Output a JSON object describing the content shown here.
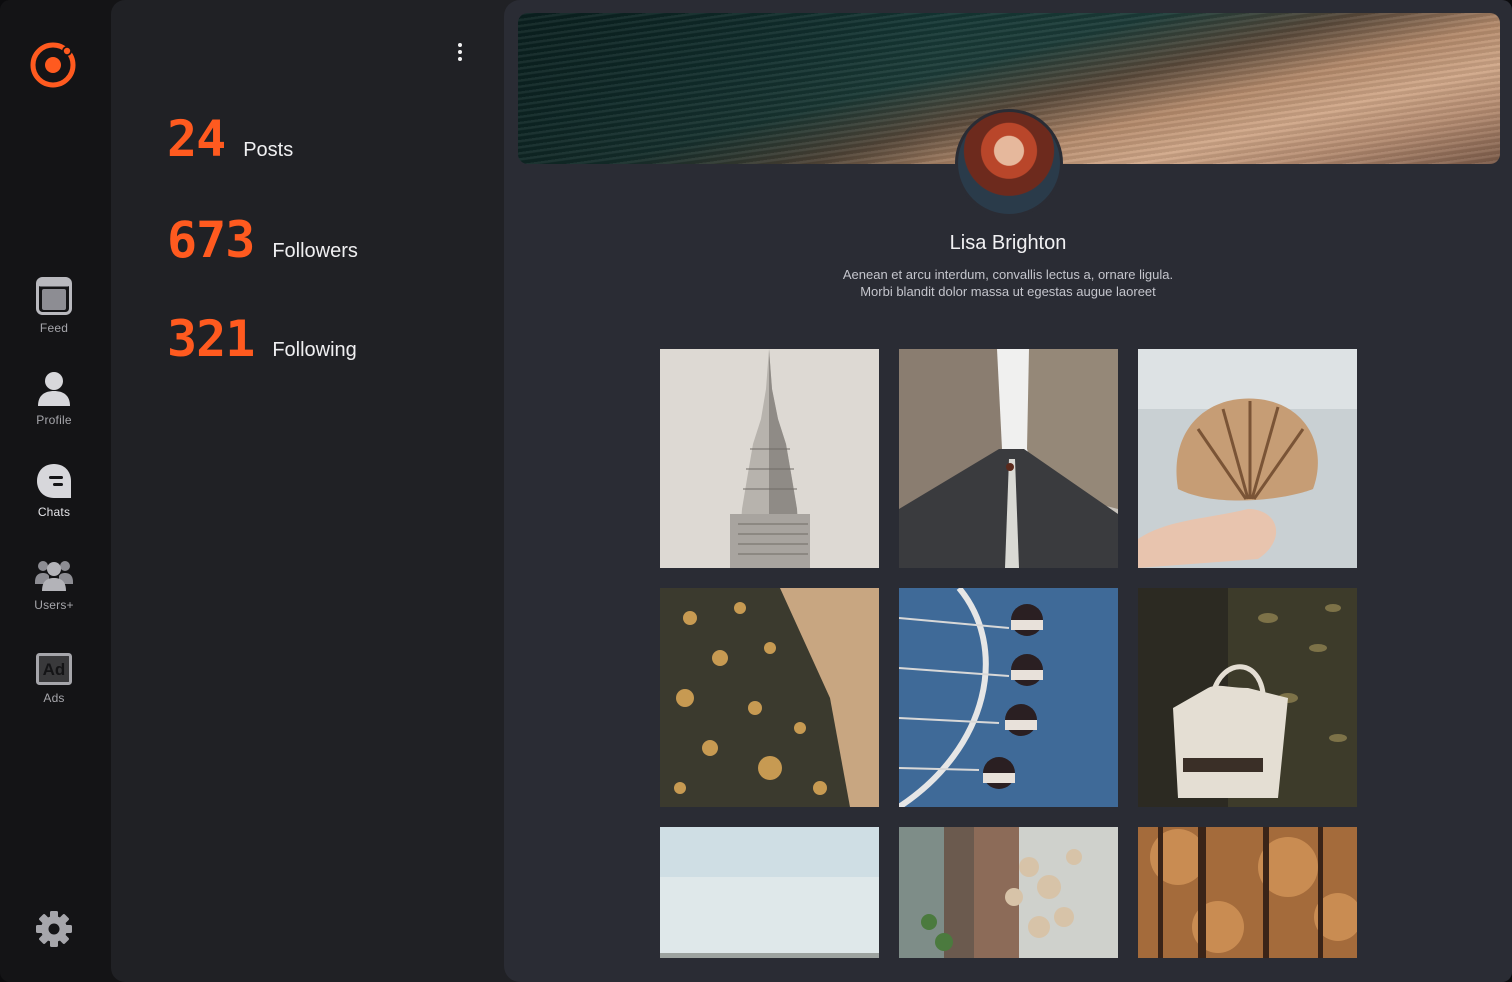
{
  "nav": {
    "items": [
      {
        "label": "Feed",
        "icon": "feed-icon"
      },
      {
        "label": "Profile",
        "icon": "profile-icon"
      },
      {
        "label": "Chats",
        "icon": "chats-icon"
      },
      {
        "label": "Users+",
        "icon": "users-icon"
      },
      {
        "label": "Ads",
        "icon": "ads-icon"
      }
    ],
    "active": "Chats",
    "logo_icon": "ring-logo-icon",
    "settings_icon": "gear-icon"
  },
  "stats": {
    "items": [
      {
        "number": "24",
        "label": "Posts"
      },
      {
        "number": "673",
        "label": "Followers"
      },
      {
        "number": "321",
        "label": "Following"
      }
    ],
    "menu_icon": "kebab-menu-icon"
  },
  "profile": {
    "name": "Lisa Brighton",
    "bio_line1": "Aenean et arcu interdum, convallis lectus a, ornare ligula.",
    "bio_line2": "Morbi blandit dolor massa ut egestas augue laoreet"
  },
  "colors": {
    "accent": "#ff5a1f",
    "rail_bg": "#141416",
    "stats_bg": "#202125",
    "profile_bg": "#2a2c34"
  }
}
